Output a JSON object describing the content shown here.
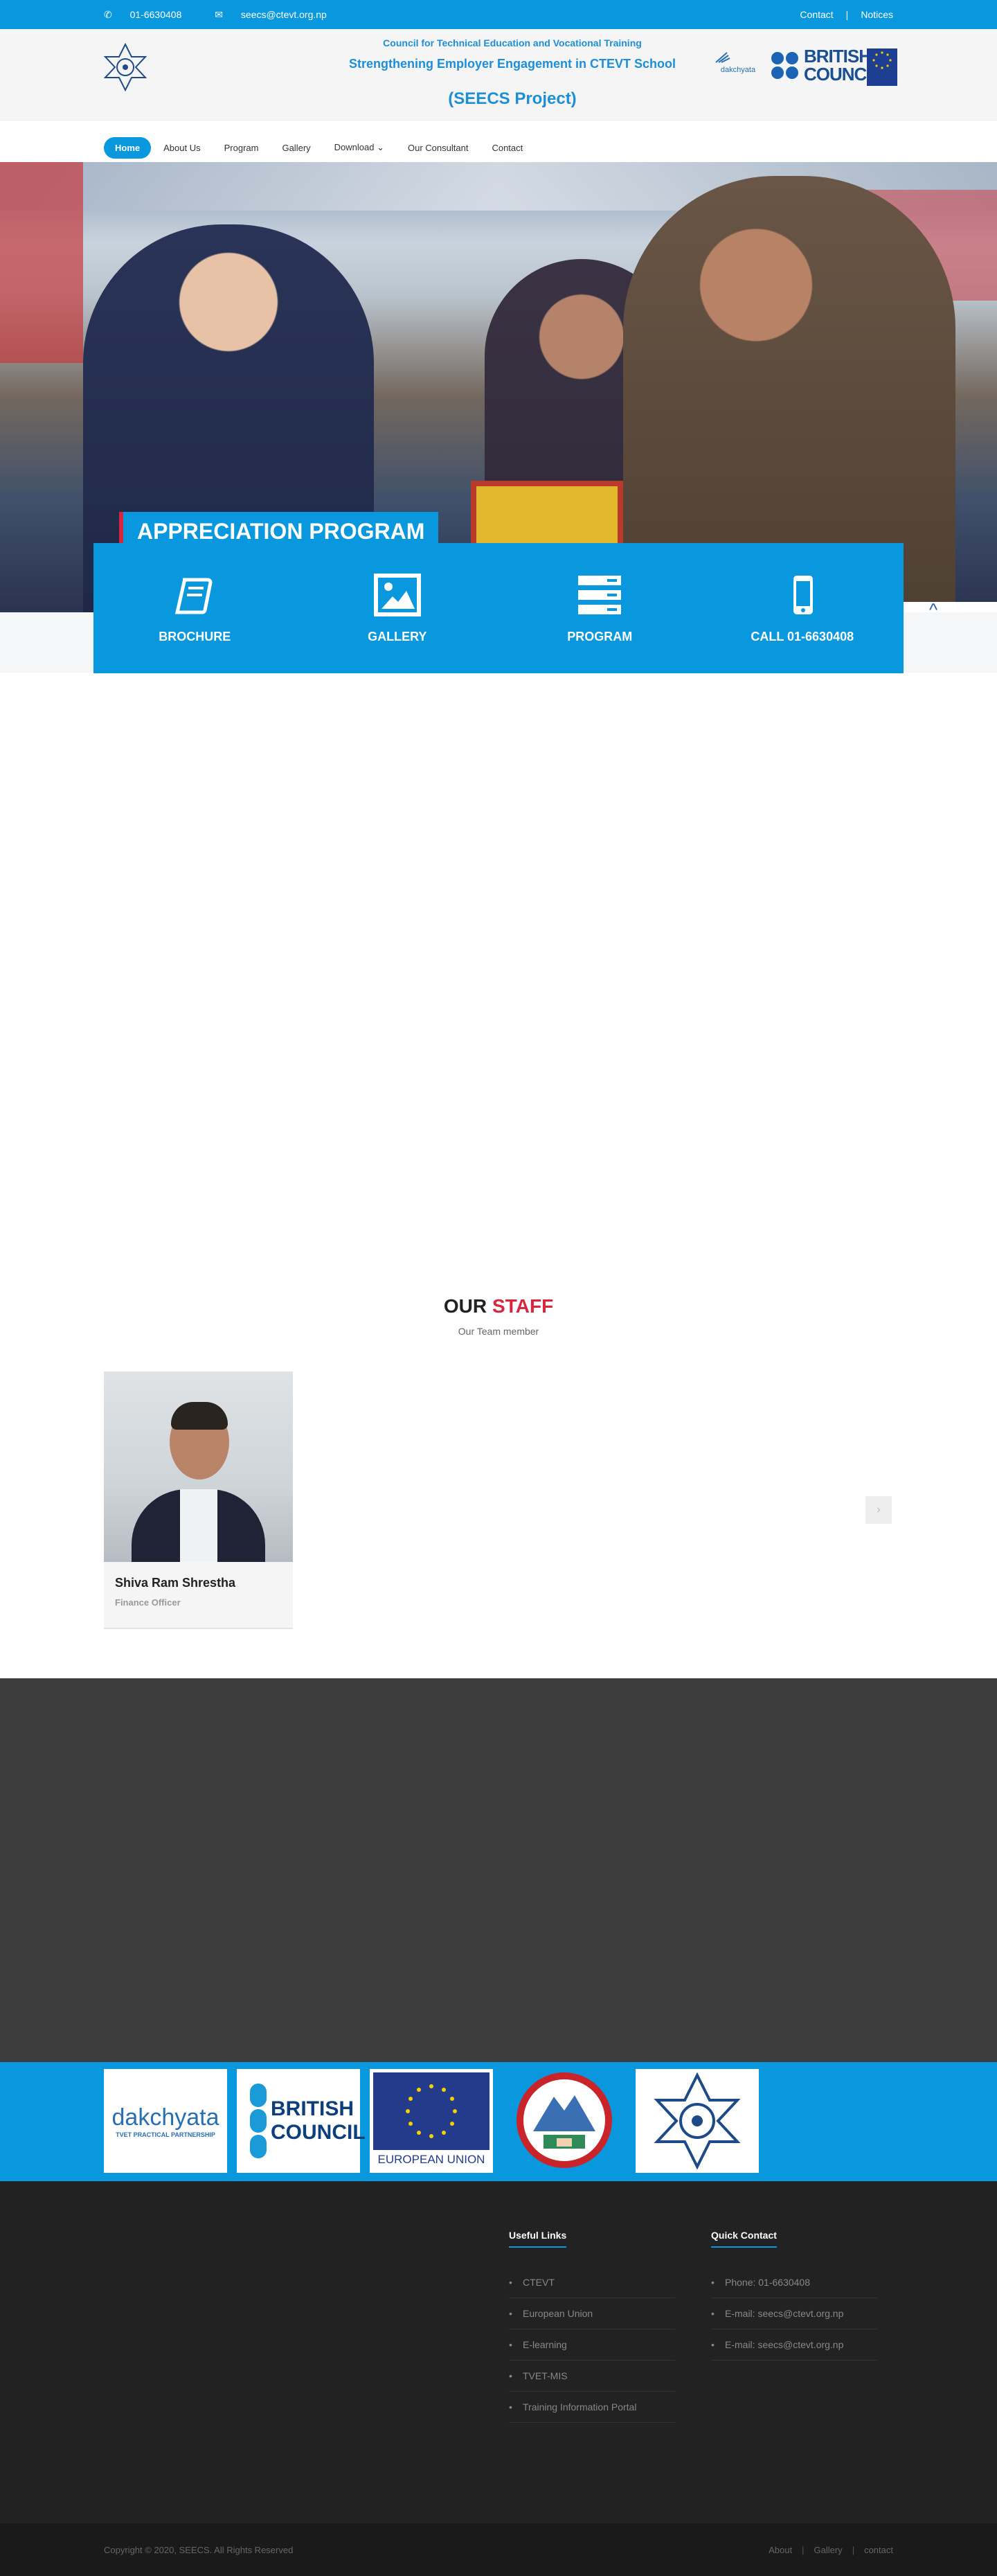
{
  "topbar": {
    "phone": "01-6630408",
    "email": "seecs@ctevt.org.np",
    "links": [
      "Contact",
      "Notices"
    ]
  },
  "header": {
    "line1": "Council for Technical Education and Vocational Training",
    "line2": "Strengthening Employer Engagement in CTEVT School",
    "line3": "(SEECS Project)",
    "partner_dakchyata": "dakchyata",
    "partner_bc": "BRITISH COUNCIL"
  },
  "nav": {
    "items": [
      "Home",
      "About Us",
      "Program",
      "Gallery",
      "Download",
      "Our Consultant",
      "Contact"
    ],
    "download_caret": "⌄"
  },
  "hero": {
    "title": "APPRECIATION PROGRAM",
    "scroll_glyph": "^"
  },
  "features": [
    {
      "label": "BROCHURE",
      "icon": "book-icon"
    },
    {
      "label": "GALLERY",
      "icon": "image-icon"
    },
    {
      "label": "PROGRAM",
      "icon": "server-icon"
    },
    {
      "label": "CALL 01-6630408",
      "icon": "mobile-icon"
    }
  ],
  "staff": {
    "title_plain": "OUR",
    "title_accent": "STAFF",
    "subtitle": "Our Team member",
    "members": [
      {
        "name": "Shiva Ram Shrestha",
        "role": "Finance Officer"
      }
    ],
    "prev": "‹",
    "next": "›"
  },
  "partners": [
    {
      "name": "dakchyata",
      "sub": "TVET PRACTICAL PARTNERSHIP"
    },
    {
      "name": "BRITISH COUNCIL",
      "sub": ""
    },
    {
      "name": "EUROPEAN UNION",
      "sub": ""
    },
    {
      "name": "",
      "sub": ""
    },
    {
      "name": "",
      "sub": ""
    }
  ],
  "footer": {
    "useful_title": "Useful Links",
    "useful_links": [
      "CTEVT",
      "European Union",
      "E-learning",
      "TVET-MIS",
      "Training Information Portal"
    ],
    "contact_title": "Quick Contact",
    "contact_items": [
      "Phone: 01-6630408",
      "E-mail: seecs@ctevt.org.np",
      "E-mail: seecs@ctevt.org.np"
    ],
    "copyright": "Copyright © 2020, SEECS. All Rights Reserved",
    "bottom_links": [
      "About",
      "Gallery",
      "contact"
    ]
  },
  "colors": {
    "primary": "#0998dd",
    "accent": "#d7263d",
    "footer": "#222222"
  }
}
